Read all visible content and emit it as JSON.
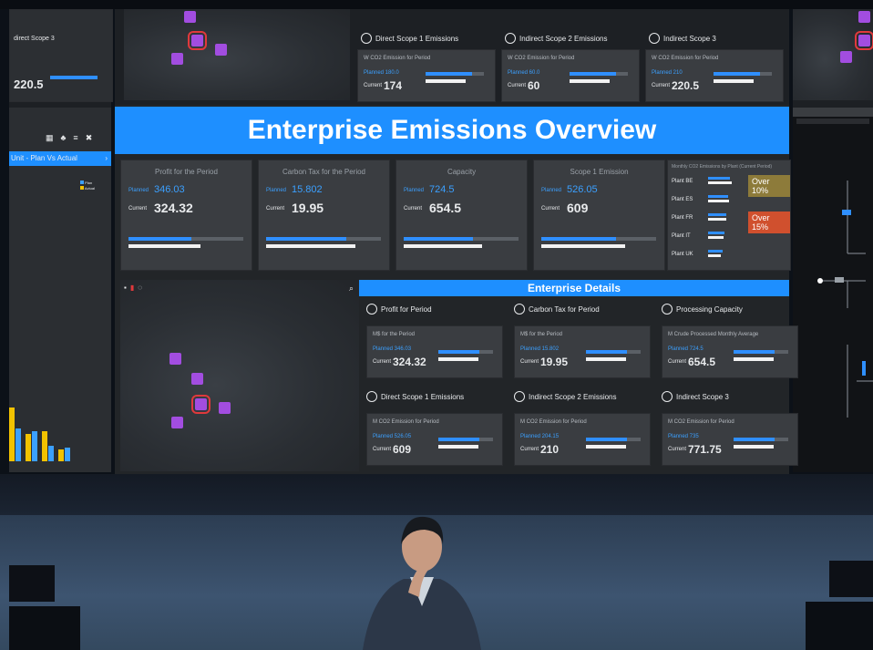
{
  "main_title": "Enterprise Emissions Overview",
  "details_title": "Enterprise Details",
  "top_strip": {
    "cards": [
      {
        "title": "Direct Scope 1 Emissions",
        "sub": "W CO2 Emission for Period",
        "planned": "Planned 180.0",
        "current_label": "Current",
        "current": "174"
      },
      {
        "title": "Indirect Scope 2 Emissions",
        "sub": "W CO2 Emission for Period",
        "planned": "Planned 60.0",
        "current_label": "Current",
        "current": "60"
      },
      {
        "title": "Indirect Scope 3",
        "sub": "W CO2 Emission for Period",
        "planned": "Planned 210",
        "current_label": "Current",
        "current": "220.5"
      }
    ],
    "left_title": "direct Scope 3",
    "left_value": "220.5"
  },
  "kpis": [
    {
      "label": "Profit for the Period",
      "planned": "346.03",
      "current": "324.32",
      "fill": 0.55
    },
    {
      "label": "Carbon Tax for the Period",
      "planned": "15.802",
      "current": "19.95",
      "fill": 0.7
    },
    {
      "label": "Capacity",
      "planned": "724.5",
      "current": "654.5",
      "fill": 0.6
    },
    {
      "label": "Scope 1 Emission",
      "planned": "526.05",
      "current": "609",
      "fill": 0.65
    }
  ],
  "kpi_words": {
    "planned": "Planned",
    "current": "Current"
  },
  "plants": {
    "title": "Monthly CO2 Emissions by Plant (Current Period)",
    "rows": [
      {
        "name": "Plant BE",
        "badge": "Over 10%",
        "badge_color": "#8d7b3a"
      },
      {
        "name": "Plant ES",
        "badge": "",
        "badge_color": ""
      },
      {
        "name": "Plant FR",
        "badge": "Over 15%",
        "badge_color": "#d0502e"
      },
      {
        "name": "Plant IT",
        "badge": "",
        "badge_color": ""
      },
      {
        "name": "Plant UK",
        "badge": "",
        "badge_color": ""
      }
    ]
  },
  "details": [
    {
      "icon": "document-icon",
      "title": "Profit for Period",
      "sub": "M$ for the Period",
      "planned": "Planned 346.03",
      "current_label": "Current",
      "current": "324.32"
    },
    {
      "icon": "tax-icon",
      "title": "Carbon Tax for Period",
      "sub": "M$ for the Period",
      "planned": "Planned 15.802",
      "current_label": "Current",
      "current": "19.95"
    },
    {
      "icon": "factory-icon",
      "title": "Processing Capacity",
      "sub": "M Crude Processed Monthly Average",
      "planned": "Planned 724.5",
      "current_label": "Current",
      "current": "654.5"
    },
    {
      "icon": "scope1-icon",
      "title": "Direct Scope 1 Emissions",
      "sub": "M CO2 Emission for Period",
      "planned": "Planned 526.05",
      "current_label": "Current",
      "current": "609"
    },
    {
      "icon": "scope2-icon",
      "title": "Indirect Scope 2 Emissions",
      "sub": "M CO2 Emission for Period",
      "planned": "Planned 204.15",
      "current_label": "Current",
      "current": "210"
    },
    {
      "icon": "scope3-icon",
      "title": "Indirect Scope 3",
      "sub": "M CO2 Emission for Period",
      "planned": "Planned 735",
      "current_label": "Current",
      "current": "771.75"
    }
  ],
  "left_panel": {
    "header": "Unit - Plan Vs Actual",
    "legend": [
      "Plan",
      "Actual"
    ],
    "bars": [
      {
        "plan": 0.9,
        "actual": 0.55
      },
      {
        "plan": 0.45,
        "actual": 0.5
      },
      {
        "plan": 0.5,
        "actual": 0.25
      },
      {
        "plan": 0.2,
        "actual": 0.22
      }
    ]
  },
  "colors": {
    "accent": "#1e8fff",
    "plan": "#3ba0ff",
    "actual": "#f2c200",
    "marker": "#a24de0"
  }
}
